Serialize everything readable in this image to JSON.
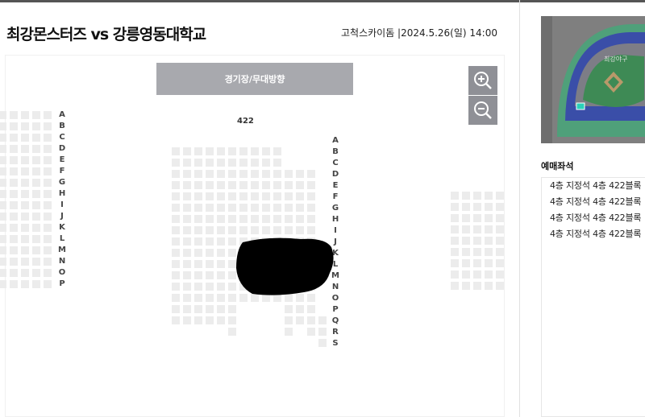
{
  "header": {
    "title": "최강몬스터즈 vs 강릉영동대학교",
    "venue_datetime": "고척스카이돔 |2024.5.26(일) 14:00"
  },
  "seatmap": {
    "stage_label": "경기장/무대방향",
    "block_label": "422",
    "zoom_in_icon": "zoom-in-icon",
    "zoom_out_icon": "zoom-out-icon",
    "left_rows": [
      "A",
      "B",
      "C",
      "D",
      "E",
      "F",
      "G",
      "H",
      "I",
      "J",
      "K",
      "L",
      "M",
      "N",
      "O",
      "P"
    ],
    "right_rows": [
      "A",
      "B",
      "C",
      "D",
      "E",
      "F",
      "G",
      "H",
      "I",
      "J",
      "K",
      "L",
      "M",
      "N",
      "O",
      "P",
      "Q",
      "R",
      "S"
    ]
  },
  "minimap": {
    "label": "최강야구",
    "colors": {
      "bg": "#7f7f7f",
      "field": "#3e8a55",
      "stands_blue": "#3a4ea8",
      "stands_green": "#4fa07a",
      "highlight": "#2ad0b8"
    }
  },
  "reserved": {
    "title": "예매좌석",
    "items": [
      "4층 지정석 4층 422블록",
      "4층 지정석 4층 422블록",
      "4층 지정석 4층 422블록",
      "4층 지정석 4층 422블록"
    ]
  },
  "colors": {
    "stage": "#a8a9ae",
    "seat": "#ececec",
    "zoom": "#8f9096"
  }
}
